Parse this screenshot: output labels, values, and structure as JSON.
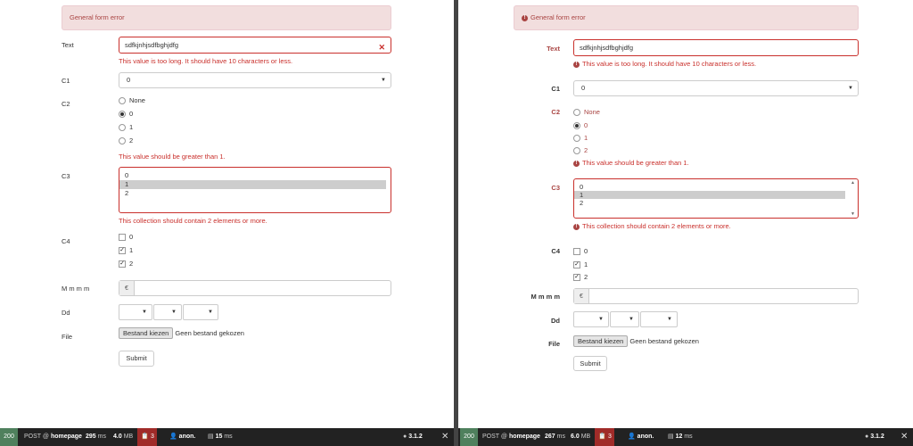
{
  "left": {
    "alert": "General form error",
    "text_label": "Text",
    "text_value": "sdfkjnhjsdfbghjdfg",
    "text_error": "This value is too long. It should have 10 characters or less.",
    "c1_label": "C1",
    "c1_value": "0",
    "c2_label": "C2",
    "c2_options": [
      "None",
      "0",
      "1",
      "2"
    ],
    "c2_selected": "0",
    "c2_error": "This value should be greater than 1.",
    "c3_label": "C3",
    "c3_options": [
      "0",
      "1",
      "2"
    ],
    "c3_selected": "1",
    "c3_error": "This collection should contain 2 elements or more.",
    "c4_label": "C4",
    "c4_options": [
      "0",
      "1",
      "2"
    ],
    "c4_checked": [
      "1",
      "2"
    ],
    "money_label": "M m m m",
    "money_addon": "€",
    "dd_label": "Dd",
    "file_label": "File",
    "file_button": "Bestand kiezen",
    "file_none": "Geen bestand gekozen",
    "submit": "Submit"
  },
  "right": {
    "alert": "General form error",
    "text_label": "Text",
    "text_value": "sdfkjnhjsdfbghjdfg",
    "text_error": "This value is too long. It should have 10 characters or less.",
    "c1_label": "C1",
    "c1_value": "0",
    "c2_label": "C2",
    "c2_options": [
      "None",
      "0",
      "1",
      "2"
    ],
    "c2_selected": "0",
    "c2_error": "This value should be greater than 1.",
    "c3_label": "C3",
    "c3_options": [
      "0",
      "1",
      "2"
    ],
    "c3_selected": "1",
    "c3_error": "This collection should contain 2 elements or more.",
    "c4_label": "C4",
    "c4_options": [
      "0",
      "1",
      "2"
    ],
    "c4_checked": [
      "1",
      "2"
    ],
    "money_label": "M m m m",
    "money_addon": "€",
    "dd_label": "Dd",
    "file_label": "File",
    "file_button": "Bestand kiezen",
    "file_none": "Geen bestand gekozen",
    "submit": "Submit"
  },
  "toolbar_left": {
    "status": "200",
    "method": "POST @",
    "route": "homepage",
    "time": "295",
    "time_unit": "ms",
    "memory": "4.0",
    "memory_unit": "MB",
    "errors": "3",
    "user": "anon.",
    "db_time": "15",
    "db_unit": "ms",
    "version": "3.1.2",
    "close": "✕"
  },
  "toolbar_right": {
    "status": "200",
    "method": "POST @",
    "route": "homepage",
    "time": "267",
    "time_unit": "ms",
    "memory": "6.0",
    "memory_unit": "MB",
    "errors": "3",
    "user": "anon.",
    "db_time": "12",
    "db_unit": "ms",
    "version": "3.1.2",
    "close": "✕"
  },
  "colors": {
    "error": "#a94442",
    "error_border": "#c9302c",
    "alert_bg": "#f2dede",
    "toolbar_bg": "#222222",
    "status_green": "#4f805d",
    "status_red": "#a02b29"
  }
}
